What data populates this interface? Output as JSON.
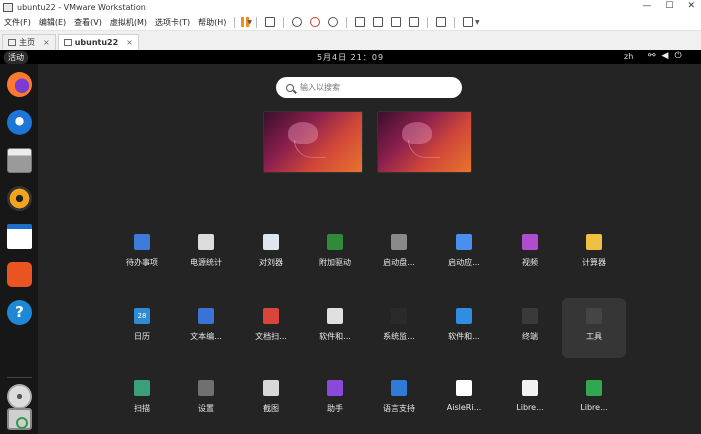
{
  "window": {
    "title": "ubuntu22 - VMware Workstation",
    "controls": {
      "minimize": "—",
      "maximize": "☐",
      "close": "✕"
    }
  },
  "menubar": {
    "items": [
      "文件(F)",
      "编辑(E)",
      "查看(V)",
      "虚拟机(M)",
      "选项卡(T)",
      "帮助(H)"
    ]
  },
  "tabs": [
    {
      "label": "主页",
      "icon": "home-icon"
    },
    {
      "label": "ubuntu22",
      "icon": "vm-icon"
    }
  ],
  "guest": {
    "topbar": {
      "activities": "活动",
      "clock": "5月4日 21：09",
      "lang": "zh",
      "sys_icons": [
        "network-icon",
        "volume-icon",
        "power-icon"
      ]
    },
    "dock": [
      {
        "name": "firefox"
      },
      {
        "name": "thunderbird"
      },
      {
        "name": "files"
      },
      {
        "name": "rhythmbox"
      },
      {
        "name": "libreoffice-writer"
      },
      {
        "name": "ubuntu-software"
      },
      {
        "name": "help",
        "glyph": "?"
      },
      {
        "name": "dvd"
      },
      {
        "name": "trash"
      }
    ],
    "search": {
      "placeholder": "输入以搜索"
    },
    "apps": [
      [
        {
          "label": "待办事项",
          "color": "#3d7bd9"
        },
        {
          "label": "电源统计",
          "color": "#dcdcdc"
        },
        {
          "label": "对刘器",
          "color": "#dfe6f0"
        },
        {
          "label": "附加驱动",
          "color": "#2f8a3a"
        },
        {
          "label": "启动盘...",
          "color": "#8a8a8a"
        },
        {
          "label": "启动应...",
          "color": "#4a8ef0"
        },
        {
          "label": "视频",
          "color": "#b24ccf"
        },
        {
          "label": "计算器",
          "color": "#f0c040"
        }
      ],
      [
        {
          "label": "日历",
          "color": "#2c8cd6",
          "glyph": "28"
        },
        {
          "label": "文本编...",
          "color": "#3b72d6"
        },
        {
          "label": "文档扫...",
          "color": "#d9453a"
        },
        {
          "label": "软件和...",
          "color": "#e0e0e0"
        },
        {
          "label": "系统监...",
          "color": "#2a2a2a"
        },
        {
          "label": "软件和...",
          "color": "#2e8fe0"
        },
        {
          "label": "终端",
          "color": "#3a3a3a"
        },
        {
          "label": "工具",
          "color": "#454545"
        }
      ],
      [
        {
          "label": "扫描",
          "color": "#3aa07a"
        },
        {
          "label": "设置",
          "color": "#707070"
        },
        {
          "label": "截图",
          "color": "#d8d8d8"
        },
        {
          "label": "助手",
          "color": "#8a49d9"
        },
        {
          "label": "语言支持",
          "color": "#2e7ad6"
        },
        {
          "label": "AisleRi...",
          "color": "#ffffff"
        },
        {
          "label": "Libre...",
          "color": "#f2f2f2"
        },
        {
          "label": "Libre...",
          "color": "#2fa84f"
        }
      ]
    ]
  }
}
